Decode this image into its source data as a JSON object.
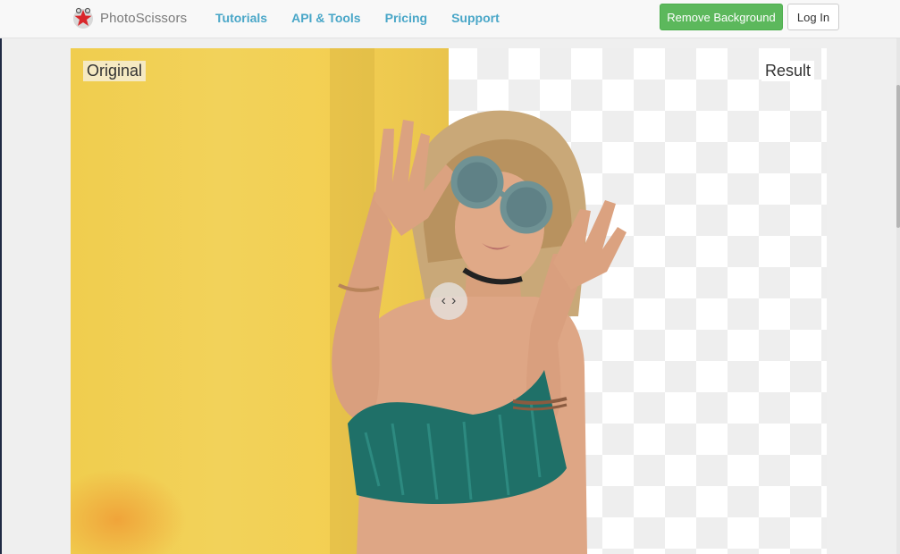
{
  "header": {
    "brand": "PhotoScissors",
    "nav": [
      "Tutorials",
      "API & Tools",
      "Pricing",
      "Support"
    ],
    "remove_background": "Remove Background",
    "login": "Log In"
  },
  "compare": {
    "label_original": "Original",
    "label_result": "Result",
    "prev_glyph": "‹",
    "next_glyph": "›"
  },
  "colors": {
    "accent_link": "#4aa7c8",
    "primary_button": "#5cb85c",
    "wall_yellow": "#f2d25a"
  },
  "icons": [
    "photoscissors-logo-icon",
    "chevron-left-icon",
    "chevron-right-icon"
  ]
}
